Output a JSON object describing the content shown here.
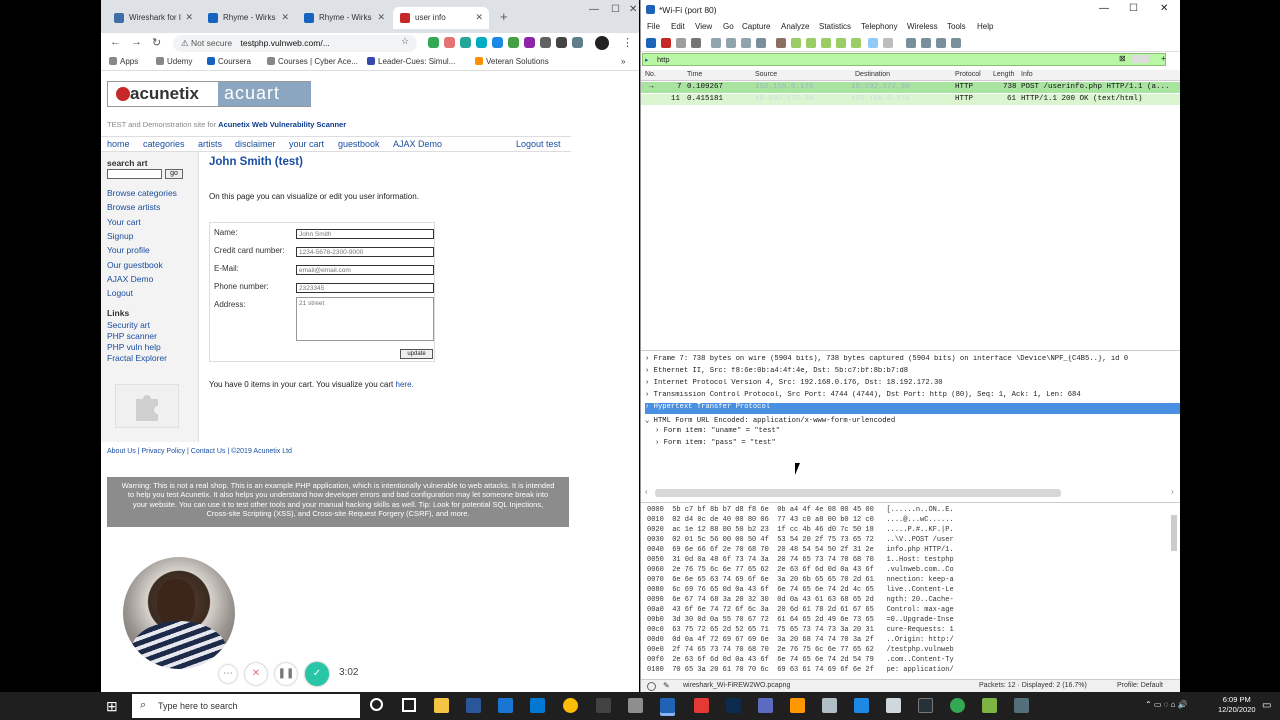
{
  "browser": {
    "tabs": [
      {
        "label": "Wireshark for I",
        "color": "#3d6ea8"
      },
      {
        "label": "Rhyme - Wirks",
        "color": "#1565c0"
      },
      {
        "label": "Rhyme - Wirks",
        "color": "#1565c0"
      },
      {
        "label": "user info",
        "color": "#c62828"
      }
    ],
    "not_secure": "Not secure",
    "url": "testphp.vulnweb.com/...",
    "bookmarks": [
      "Apps",
      "Udemy",
      "Coursera",
      "Courses | Cyber Ace...",
      "Leader-Cues: Simul...",
      "Veteran Solutions"
    ]
  },
  "page": {
    "logo_left": "acunetix",
    "logo_right": "acuart",
    "tagline_prefix": "TEST and Demonstration site for",
    "tagline_brand": "Acunetix Web Vulnerability Scanner",
    "topnav": [
      "home",
      "categories",
      "artists",
      "disclaimer",
      "your cart",
      "guestbook",
      "AJAX Demo"
    ],
    "logout": "Logout test",
    "search_label": "search art",
    "search_go": "go",
    "left_links": [
      "Browse categories",
      "Browse artists",
      "Your cart",
      "Signup",
      "Your profile",
      "Our guestbook",
      "AJAX Demo",
      "Logout"
    ],
    "links_heading": "Links",
    "ext_links": [
      "Security art",
      "PHP scanner",
      "PHP vuln help",
      "Fractal Explorer"
    ],
    "user_title": "John Smith (test)",
    "user_info": "On this page you can visualize or edit you user information.",
    "form": {
      "name_label": "Name:",
      "name_value": "John Smith",
      "card_label": "Credit card number:",
      "card_value": "1234-5678-2300-9000",
      "email_label": "E-Mail:",
      "email_value": "email@email.com",
      "phone_label": "Phone number:",
      "phone_value": "2323345",
      "address_label": "Address:",
      "address_value": "21 street",
      "update": "update"
    },
    "cart_text": "You have 0 items in your cart. You visualize you cart",
    "cart_link": "here.",
    "footer_links": "About Us | Privacy Policy | Contact Us | ©2019 Acunetix Ltd",
    "warning": "Warning: This is not a real shop. This is an example PHP application, which is intentionally vulnerable to web attacks. It is intended to help you test Acunetix. It also helps you understand how developer errors and bad configuration may let someone break into your website. You can use it to test other tools and your manual hacking skills as well. Tip: Look for potential SQL Injections, Cross-site Scripting (XSS), and Cross-site Request Forgery (CSRF), and more."
  },
  "recorder": {
    "time": "3:02"
  },
  "wireshark": {
    "title": "*Wi-Fi (port 80)",
    "menu": [
      "File",
      "Edit",
      "View",
      "Go",
      "Capture",
      "Analyze",
      "Statistics",
      "Telephony",
      "Wireless",
      "Tools",
      "Help"
    ],
    "filter": "http",
    "columns": [
      "No.",
      "Time",
      "Source",
      "Destination",
      "Protocol",
      "Length",
      "Info"
    ],
    "packets": [
      {
        "no": "7",
        "time": "0.109267",
        "src": "192.168.0.176",
        "dst": "18.192.172.30",
        "proto": "HTTP",
        "len": "738",
        "info": "POST /userinfo.php HTTP/1.1  (a..."
      },
      {
        "no": "11",
        "time": "0.415181",
        "src": "18.192.172.30",
        "dst": "192.168.0.176",
        "proto": "HTTP",
        "len": "61",
        "info": "HTTP/1.1 200 OK  (text/html)"
      }
    ],
    "details": [
      "Frame 7: 738 bytes on wire (5904 bits), 738 bytes captured (5904 bits) on interface \\Device\\NPF_{C4B5..}, id 0",
      "Ethernet II, Src: f8:6e:0b:a4:4f:4e, Dst: 5b:c7:bf:8b:b7:d8",
      "Internet Protocol Version 4, Src: 192.168.0.176, Dst: 18.192.172.30",
      "Transmission Control Protocol, Src Port: 4744 (4744), Dst Port: http (80), Seq: 1, Ack: 1, Len: 684",
      "Hypertext Transfer Protocol",
      "HTML Form URL Encoded: application/x-www-form-urlencoded",
      "Form item: \"uname\" = \"test\"",
      "Form item: \"pass\" = \"test\""
    ],
    "hex": [
      "0000  5b c7 bf 8b b7 d8 f8 6e  0b a4 4f 4e 08 00 45 00   [......n..ON..E.",
      "0010  02 d4 0c de 40 00 80 06  77 43 c0 a8 00 b0 12 c0   ....@...wC......",
      "0020  ac 1e 12 88 00 50 b2 23  1f cc 4b 46 d0 7c 50 18   .....P.#..KF.|P.",
      "0030  02 01 5c 56 00 00 50 4f  53 54 20 2f 75 73 65 72   ..\\V..POST /user",
      "0040  69 6e 66 6f 2e 70 68 70  20 48 54 54 50 2f 31 2e   info.php HTTP/1.",
      "0050  31 0d 0a 48 6f 73 74 3a  20 74 65 73 74 70 68 70   1..Host: testphp",
      "0060  2e 76 75 6c 6e 77 65 62  2e 63 6f 6d 0d 0a 43 6f   .vulnweb.com..Co",
      "0070  6e 6e 65 63 74 69 6f 6e  3a 20 6b 65 65 70 2d 61   nnection: keep-a",
      "0080  6c 69 76 65 0d 0a 43 6f  6e 74 65 6e 74 2d 4c 65   live..Content-Le",
      "0090  6e 67 74 68 3a 20 32 30  0d 0a 43 61 63 68 65 2d   ngth: 20..Cache-",
      "00a0  43 6f 6e 74 72 6f 6c 3a  20 6d 61 78 2d 61 67 65   Control: max-age",
      "00b0  3d 30 0d 0a 55 70 67 72  61 64 65 2d 49 6e 73 65   =0..Upgrade-Inse",
      "00c0  63 75 72 65 2d 52 65 71  75 65 73 74 73 3a 20 31   cure-Requests: 1",
      "00d0  0d 0a 4f 72 69 67 69 6e  3a 20 68 74 74 70 3a 2f   ..Origin: http:/",
      "00e0  2f 74 65 73 74 70 68 70  2e 76 75 6c 6e 77 65 62   /testphp.vulnweb",
      "00f0  2e 63 6f 6d 0d 0a 43 6f  6e 74 65 6e 74 2d 54 79   .com..Content-Ty",
      "0100  70 65 3a 20 61 70 70 6c  69 63 61 74 69 6f 6e 2f   pe: application/"
    ],
    "status_file": "wireshark_Wi-FiREW2WO.pcapng",
    "status_packets": "Packets: 12 · Displayed: 2 (16.7%)",
    "status_profile": "Profile: Default"
  },
  "taskbar": {
    "search_placeholder": "Type here to search",
    "time": "6:09 PM",
    "date": "12/20/2020"
  }
}
